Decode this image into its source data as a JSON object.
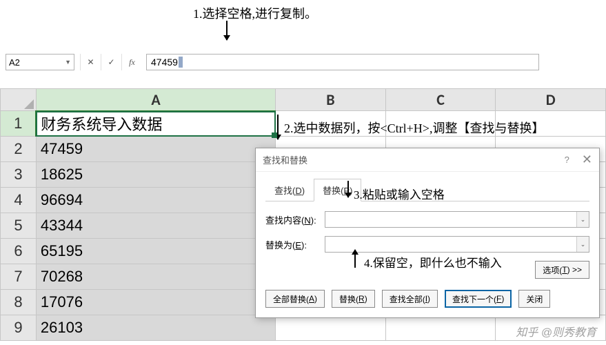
{
  "annotations": {
    "a1": "1.选择空格,进行复制。",
    "a2": "2.选中数据列，按<Ctrl+H>,调整【查找与替换】",
    "a3": "3.粘贴或输入空格",
    "a4": "4.保留空，即什么也不输入"
  },
  "namebox": {
    "value": "A2"
  },
  "formula_bar": {
    "cancel": "✕",
    "confirm": "✓",
    "fx": "fx",
    "value": "47459"
  },
  "columns": [
    "A",
    "B",
    "C",
    "D"
  ],
  "rows": [
    {
      "num": "1",
      "A": "财务系统导入数据"
    },
    {
      "num": "2",
      "A": "47459"
    },
    {
      "num": "3",
      "A": "18625"
    },
    {
      "num": "4",
      "A": "96694"
    },
    {
      "num": "5",
      "A": "43344"
    },
    {
      "num": "6",
      "A": "65195"
    },
    {
      "num": "7",
      "A": "70268"
    },
    {
      "num": "8",
      "A": "17076"
    },
    {
      "num": "9",
      "A": "26103"
    }
  ],
  "dialog": {
    "title": "查找和替换",
    "help": "?",
    "close": "✕",
    "tab_find": {
      "text": "查找(",
      "key": "D",
      "suffix": ")"
    },
    "tab_replace": {
      "text": "替换(",
      "key": "P",
      "suffix": ")"
    },
    "find_label": {
      "text": "查找内容(",
      "key": "N",
      "suffix": "):"
    },
    "replace_label": {
      "text": "替换为(",
      "key": "E",
      "suffix": "):"
    },
    "find_value": "",
    "replace_value": "",
    "options_btn": {
      "text": "选项(",
      "key": "T",
      "suffix": ") >>"
    },
    "btn_replace_all": {
      "text": "全部替换(",
      "key": "A",
      "suffix": ")"
    },
    "btn_replace": {
      "text": "替换(",
      "key": "R",
      "suffix": ")"
    },
    "btn_find_all": {
      "text": "查找全部(",
      "key": "I",
      "suffix": ")"
    },
    "btn_find_next": {
      "text": "查找下一个(",
      "key": "F",
      "suffix": ")"
    },
    "btn_close": "关闭"
  },
  "watermark": "知乎 @则秀教育"
}
